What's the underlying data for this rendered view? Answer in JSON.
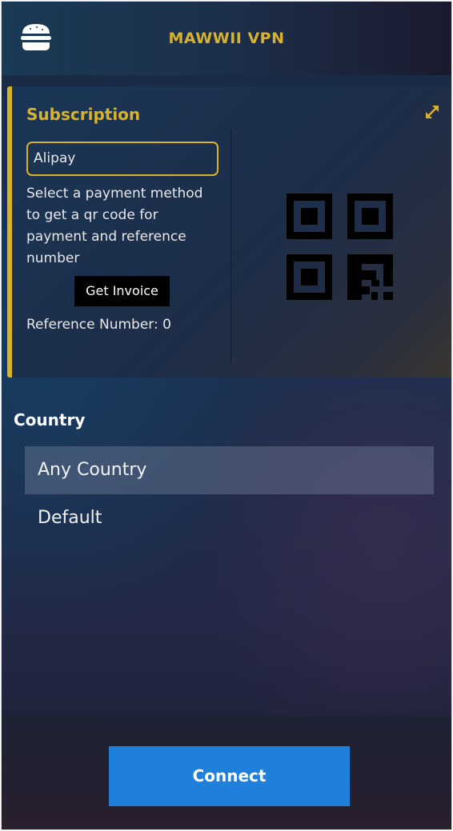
{
  "header": {
    "title": "MAWWII VPN",
    "menu_icon": "hamburger-menu-icon"
  },
  "subscription": {
    "title": "Subscription",
    "expand_icon": "expand-arrows-icon",
    "payment_method": "Alipay",
    "description": "Select a payment method to get a qr code for payment and reference number",
    "invoice_button": "Get Invoice",
    "reference_label": "Reference Number: 0",
    "qr_code": "qr-code-image"
  },
  "country": {
    "label": "Country",
    "items": [
      {
        "label": "Any Country",
        "selected": true
      },
      {
        "label": "Default",
        "selected": false
      }
    ]
  },
  "footer": {
    "connect_button": "Connect"
  },
  "colors": {
    "accent": "#d8b22b",
    "primary_button": "#1f80dc",
    "background": "#1c3050"
  }
}
